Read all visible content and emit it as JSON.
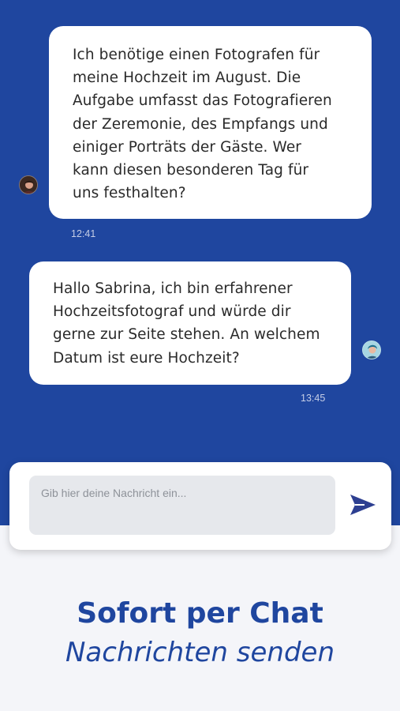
{
  "messages": [
    {
      "sender": "customer",
      "text": "Ich benötige einen Fotografen für\nmeine Hochzeit im August. Die\nAufgabe umfasst das Fotografieren\nder Zeremonie, des Empfangs und\neiniger Porträts der Gäste. Wer\nkann diesen besonderen Tag für\nuns festhalten?",
      "time": "12:41",
      "avatar_icon": "user-avatar-icon"
    },
    {
      "sender": "photographer",
      "text": "Hallo Sabrina, ich bin erfahrener\nHochzeitsfotograf und würde dir\ngerne zur Seite stehen. An welchem\nDatum ist eure Hochzeit?",
      "time": "13:45",
      "avatar_icon": "user-avatar-icon"
    }
  ],
  "composer": {
    "placeholder": "Gib hier deine Nachricht ein...",
    "value": "",
    "send_icon": "send-icon"
  },
  "promo": {
    "line1": "Sofort per Chat",
    "line2": "Nachrichten senden"
  },
  "colors": {
    "primary": "#1f469f",
    "send_icon": "#2d3f91",
    "bubble": "#ffffff",
    "timestamp": "#c4cde6",
    "page_bg": "#f4f5f9"
  }
}
